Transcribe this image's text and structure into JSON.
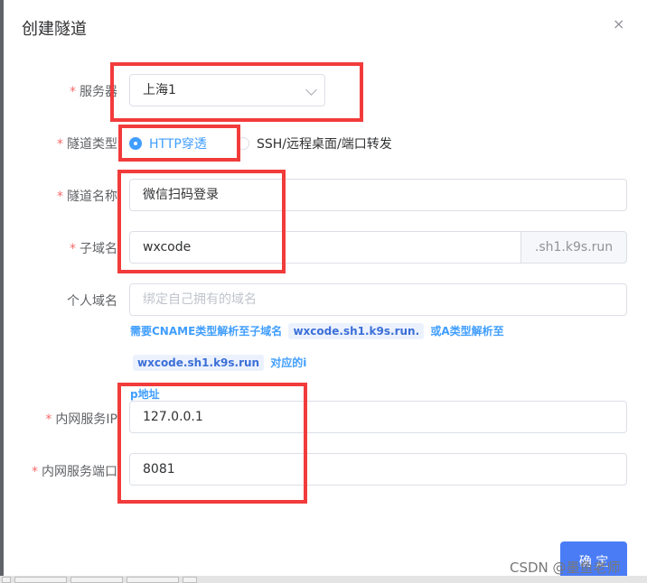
{
  "dialog": {
    "title": "创建隧道",
    "close_icon": "×"
  },
  "form": {
    "server": {
      "label": "服务器",
      "value": "上海1"
    },
    "tunnel_type": {
      "label": "隧道类型",
      "options": [
        {
          "label": "HTTP穿透",
          "checked": true
        },
        {
          "label": "SSH/远程桌面/端口转发",
          "checked": false
        }
      ]
    },
    "tunnel_name": {
      "label": "隧道名称",
      "value": "微信扫码登录"
    },
    "subdomain": {
      "label": "子域名",
      "value": "wxcode",
      "suffix": ".sh1.k9s.run"
    },
    "custom_domain": {
      "label": "个人域名",
      "placeholder": "绑定自己拥有的域名"
    },
    "hint": {
      "part1": "需要CNAME类型解析至子域名",
      "tag1": "wxcode.sh1.k9s.run.",
      "part2": "或A类型解析至",
      "tag2": "wxcode.sh1.k9s.run",
      "part3": "对应的i",
      "line2": "p地址"
    },
    "local_ip": {
      "label": "内网服务IP",
      "value": "127.0.0.1"
    },
    "local_port": {
      "label": "内网服务端口",
      "value": "8081"
    }
  },
  "footer": {
    "confirm_label": "确 定"
  },
  "watermark": "CSDN @墨鱼老师",
  "colors": {
    "primary": "#409eff",
    "required": "#f56c6c",
    "annotation_red": "#f23b3b"
  }
}
